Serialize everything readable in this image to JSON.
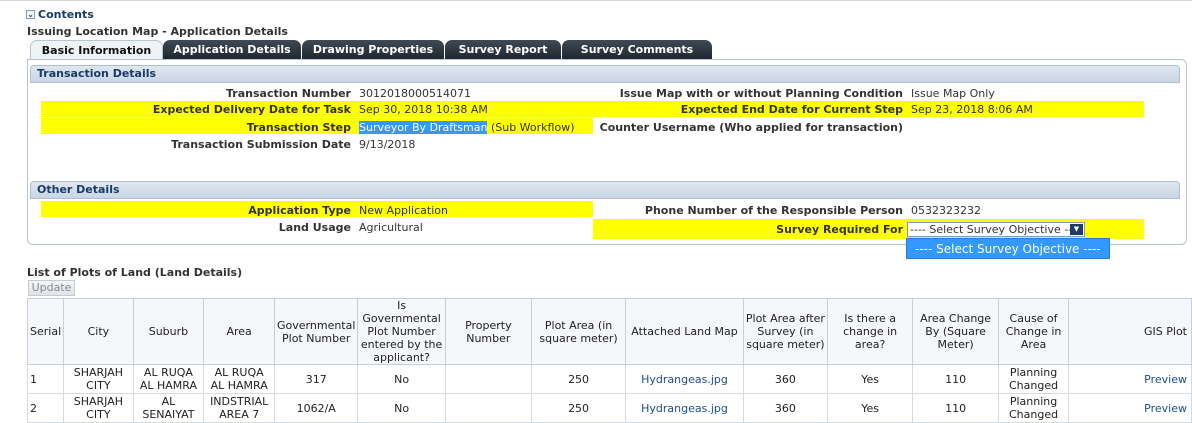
{
  "contents": {
    "label": "Contents"
  },
  "page_title": "Issuing Location Map - Application Details",
  "tabs": [
    {
      "label": "Basic Information",
      "active": true
    },
    {
      "label": "Application Details"
    },
    {
      "label": "Drawing Properties"
    },
    {
      "label": "Survey Report"
    },
    {
      "label": "Survey Comments"
    }
  ],
  "transaction": {
    "header": "Transaction Details",
    "number_label": "Transaction Number",
    "number_value": "3012018000514071",
    "issue_map_label": "Issue Map with or without Planning Condition",
    "issue_map_value": "Issue Map Only",
    "delivery_label": "Expected Delivery Date for Task",
    "delivery_value": "Sep 30, 2018 10:38 AM",
    "end_date_label": "Expected End Date for Current Step",
    "end_date_value": "Sep 23, 2018 8:06 AM",
    "step_label": "Transaction Step",
    "step_value": "Surveyor By Draftsman",
    "step_suffix": "(Sub Workflow)",
    "counter_label": "Counter Username (Who applied for transaction)",
    "submission_label": "Transaction Submission Date",
    "submission_value": "9/13/2018"
  },
  "other": {
    "header": "Other Details",
    "app_type_label": "Application Type",
    "app_type_value": "New Application",
    "phone_label": "Phone Number of the Responsible Person",
    "phone_value": "0532323232",
    "land_usage_label": "Land Usage",
    "land_usage_value": "Agricultural",
    "survey_label": "Survey Required For",
    "survey_select_value": "---- Select Survey Objective ----",
    "survey_dropdown_option": "---- Select Survey Objective ----"
  },
  "plots": {
    "title": "List of Plots of Land (Land Details)",
    "update_label": "Update",
    "columns": [
      "Serial",
      "City",
      "Suburb",
      "Area",
      "Governmental Plot Number",
      "Is Governmental Plot Number entered by the applicant?",
      "Property Number",
      "Plot Area (in square meter)",
      "Attached Land Map",
      "Plot Area after Survey (in square meter)",
      "Is there a change in area?",
      "Area Change By (Square Meter)",
      "Cause of Change in Area",
      "GIS Plot"
    ],
    "rows": [
      [
        "1",
        "SHARJAH CITY",
        "AL RUQA AL HAMRA",
        "AL RUQA AL HAMRA",
        "317",
        "No",
        "",
        "250",
        "Hydrangeas.jpg",
        "360",
        "Yes",
        "110",
        "Planning Changed",
        "Preview"
      ],
      [
        "2",
        "SHARJAH CITY",
        "AL SENAIYAT",
        "INDSTRIAL AREA 7",
        "1062/A",
        "No",
        "",
        "250",
        "Hydrangeas.jpg",
        "360",
        "Yes",
        "110",
        "Planning Changed",
        "Preview"
      ]
    ]
  }
}
